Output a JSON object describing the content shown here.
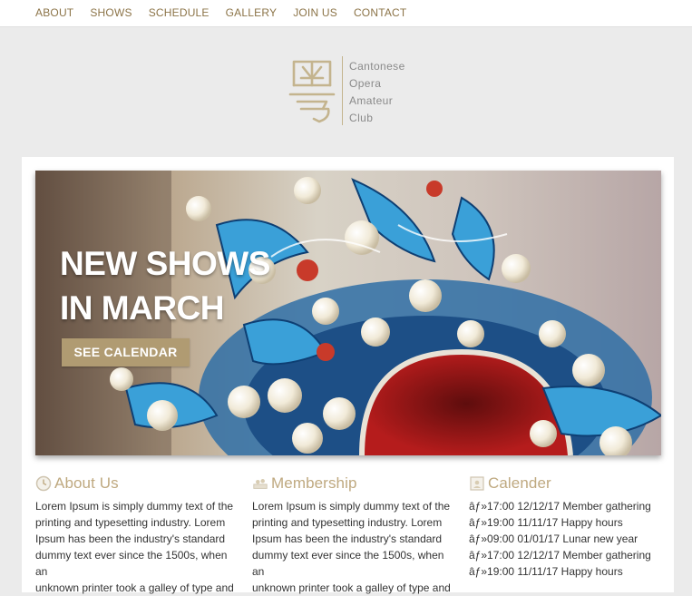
{
  "nav": {
    "items": [
      "ABOUT",
      "SHOWS",
      "SCHEDULE",
      "GALLERY",
      "JOIN US",
      "CONTACT"
    ]
  },
  "logo": {
    "glyph": "粵",
    "lines": [
      "Cantonese",
      "Opera",
      "Amateur",
      "Club"
    ]
  },
  "hero": {
    "headline": [
      "NEW SHOWS",
      "IN MARCH"
    ],
    "cta_label": "SEE CALENDAR"
  },
  "sections": {
    "about": {
      "title": "About Us",
      "icon": "clock-icon",
      "lines": [
        "Lorem Ipsum is simply dummy text of the",
        "printing and typesetting industry. Lorem",
        "Ipsum has been the industry's standard",
        "dummy text ever since the 1500s, when an",
        "unknown printer took a galley of type and"
      ]
    },
    "membership": {
      "title": "Membership",
      "icon": "membership-icon",
      "lines": [
        "Lorem Ipsum is simply dummy text of the",
        "printing and typesetting industry. Lorem",
        "Ipsum has been the industry's standard",
        "dummy text ever since the 1500s, when an",
        "unknown printer took a galley of type and"
      ]
    },
    "calendar": {
      "title": "Calender",
      "icon": "calendar-icon",
      "events": [
        "âƒ»17:00 12/12/17 Member gathering",
        "âƒ»19:00 11/11/17 Happy hours",
        "âƒ»09:00 01/01/17 Lunar new year",
        "âƒ»17:00 12/12/17 Member gathering",
        "âƒ»19:00 11/11/17 Happy hours"
      ]
    }
  },
  "colors": {
    "accent": "#8c7448",
    "heading": "#bfa980",
    "button": "#b09b72",
    "page_bg": "#ebebeb"
  }
}
